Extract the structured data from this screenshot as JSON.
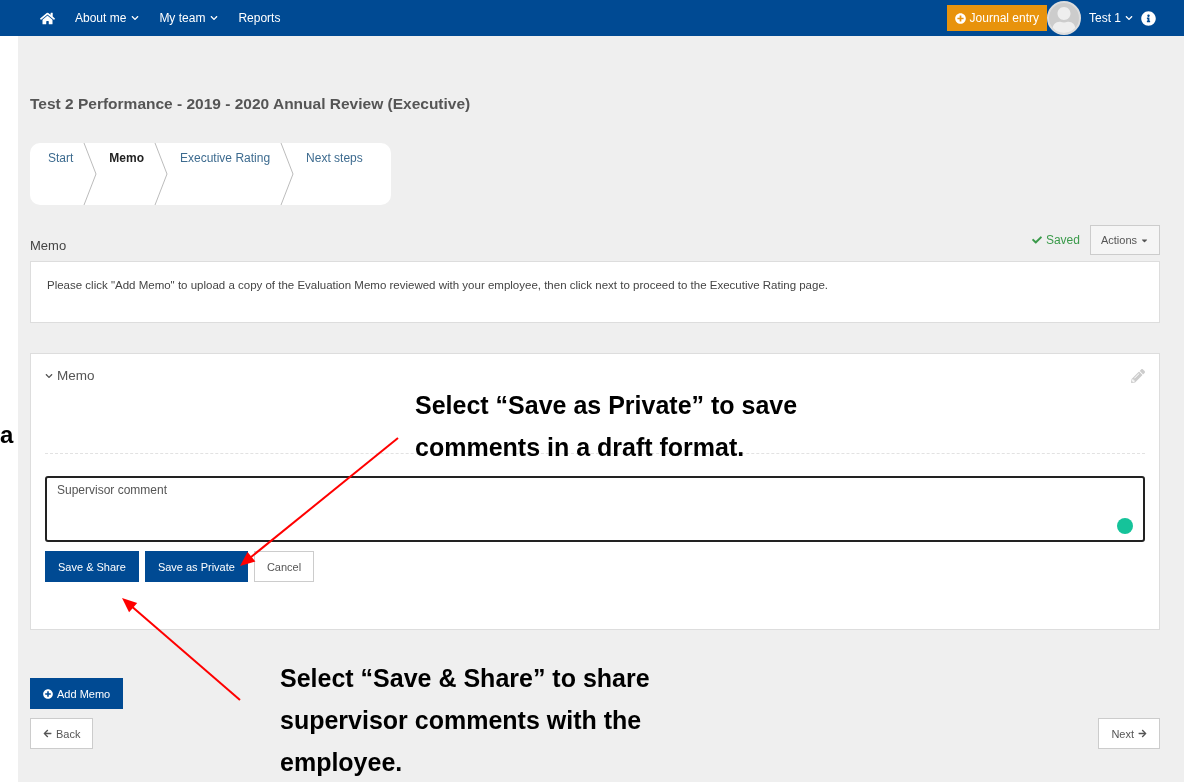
{
  "navbar": {
    "links": [
      {
        "label": "About me",
        "dropdown": true
      },
      {
        "label": "My team",
        "dropdown": true
      },
      {
        "label": "Reports",
        "dropdown": false
      }
    ],
    "journal_button": "Journal entry",
    "user": "Test 1"
  },
  "page_title": "Test 2 Performance - 2019 - 2020 Annual Review (Executive)",
  "steps": [
    {
      "label": "Start",
      "selected": false
    },
    {
      "label": "Memo",
      "selected": true
    },
    {
      "label": "Executive Rating",
      "selected": false
    },
    {
      "label": "Next steps",
      "selected": false
    }
  ],
  "section_title": "Memo",
  "save_status": "Saved",
  "actions_button": "Actions",
  "instruction": "Please click \"Add Memo\" to upload a copy of the Evaluation Memo reviewed with your employee, then click next to proceed to the Executive Rating page.",
  "memo_card": {
    "title": "Memo",
    "expanded": true,
    "comment": "Supervisor comment",
    "buttons": [
      {
        "label": "Save & Share",
        "kind": "primary"
      },
      {
        "label": "Save as Private",
        "kind": "primary"
      },
      {
        "label": "Cancel",
        "kind": "default"
      }
    ]
  },
  "add_memo_button": "Add Memo",
  "back_button": "Back",
  "next_button": "Next",
  "annotations": [
    {
      "text": "a",
      "kind": "fragment"
    },
    {
      "text": "Select “Save as Private” to save comments in a draft format.",
      "kind": "callout"
    },
    {
      "text": "Select “Save & Share” to share supervisor comments with the employee.",
      "kind": "callout"
    }
  ]
}
